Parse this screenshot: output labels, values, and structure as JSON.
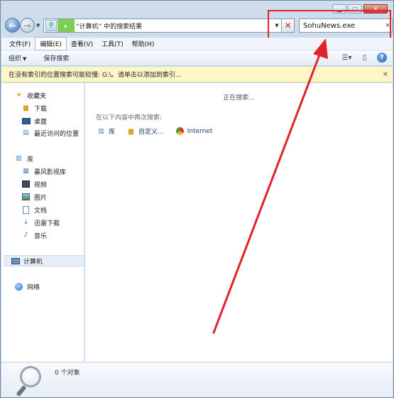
{
  "window": {
    "caption_buttons": [
      "minimize",
      "maximize",
      "close"
    ]
  },
  "address": {
    "path_label": "“计算机” 中的搜索结果",
    "separator": "▸"
  },
  "search": {
    "value": "SohuNews.exe",
    "clear": "×"
  },
  "menu": {
    "items": [
      "文件(F)",
      "编辑(E)",
      "查看(V)",
      "工具(T)",
      "帮助(H)"
    ]
  },
  "toolbar": {
    "organize": "组织",
    "save_search": "保存搜索"
  },
  "infobar": {
    "text": "在没有索引的位置搜索可能较慢: G:\\。请单击以添加到索引...",
    "close": "×"
  },
  "nav": {
    "favorites": "收藏夹",
    "downloads": "下载",
    "desktop": "桌面",
    "recent": "最近访问的位置",
    "libraries": "库",
    "baofeng": "暴风影视库",
    "videos": "视频",
    "pictures": "图片",
    "documents": "文档",
    "xunlei": "迅雷下载",
    "music": "音乐",
    "computer": "计算机",
    "network": "网络"
  },
  "content": {
    "status": "正在搜索...",
    "search_again_label": "在以下内容中再次搜索:",
    "search_again": [
      "库",
      "自定义...",
      "Internet"
    ]
  },
  "details": {
    "count": "0 个对象"
  },
  "colors": {
    "annotation_red": "#e0232b",
    "infobar_yellow": "#fdf7c8"
  }
}
